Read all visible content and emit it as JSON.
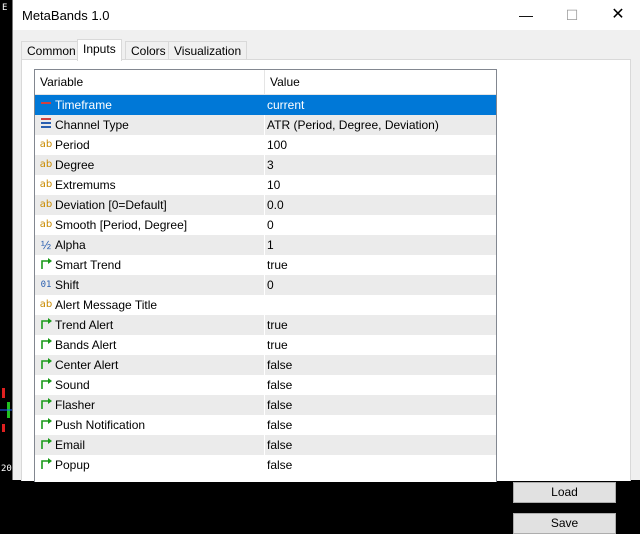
{
  "window": {
    "title": "MetaBands 1.0"
  },
  "background": {
    "edge_top": "E",
    "edge_bottom": "20"
  },
  "tabs": [
    {
      "label": "Common"
    },
    {
      "label": "Inputs"
    },
    {
      "label": "Colors"
    },
    {
      "label": "Visualization"
    }
  ],
  "active_tab": "Inputs",
  "grid": {
    "headers": {
      "variable": "Variable",
      "value": "Value"
    },
    "rows": [
      {
        "variable": "Timeframe",
        "value": "current",
        "icon": "timeframe-icon",
        "selected": true
      },
      {
        "variable": "Channel Type",
        "value": "ATR (Period, Degree, Deviation)",
        "icon": "enum-list-icon"
      },
      {
        "variable": "Period",
        "value": "100",
        "icon": "string-ab-icon"
      },
      {
        "variable": "Degree",
        "value": "3",
        "icon": "string-ab-icon"
      },
      {
        "variable": "Extremums",
        "value": "10",
        "icon": "string-ab-icon"
      },
      {
        "variable": "Deviation [0=Default]",
        "value": "0.0",
        "icon": "string-ab-icon"
      },
      {
        "variable": "Smooth [Period, Degree]",
        "value": "0",
        "icon": "string-ab-icon"
      },
      {
        "variable": "Alpha",
        "value": "1",
        "icon": "fraction-half-icon"
      },
      {
        "variable": "Smart Trend",
        "value": "true",
        "icon": "bool-arrow-icon"
      },
      {
        "variable": "Shift",
        "value": "0",
        "icon": "integer-01-icon"
      },
      {
        "variable": "Alert Message Title",
        "value": "",
        "icon": "string-ab-icon"
      },
      {
        "variable": "Trend Alert",
        "value": "true",
        "icon": "bool-arrow-icon"
      },
      {
        "variable": "Bands Alert",
        "value": "true",
        "icon": "bool-arrow-icon"
      },
      {
        "variable": "Center Alert",
        "value": "false",
        "icon": "bool-arrow-icon"
      },
      {
        "variable": "Sound",
        "value": "false",
        "icon": "bool-arrow-icon"
      },
      {
        "variable": "Flasher",
        "value": "false",
        "icon": "bool-arrow-icon"
      },
      {
        "variable": "Push Notification",
        "value": "false",
        "icon": "bool-arrow-icon"
      },
      {
        "variable": "Email",
        "value": "false",
        "icon": "bool-arrow-icon"
      },
      {
        "variable": "Popup",
        "value": "false",
        "icon": "bool-arrow-icon"
      }
    ]
  },
  "buttons": {
    "load": "Load",
    "save": "Save"
  },
  "colors": {
    "selection": "#0078d7",
    "alt_row": "#ebebeb",
    "bool_icon": "#1a9a1a",
    "ab_icon": "#c88a00"
  }
}
